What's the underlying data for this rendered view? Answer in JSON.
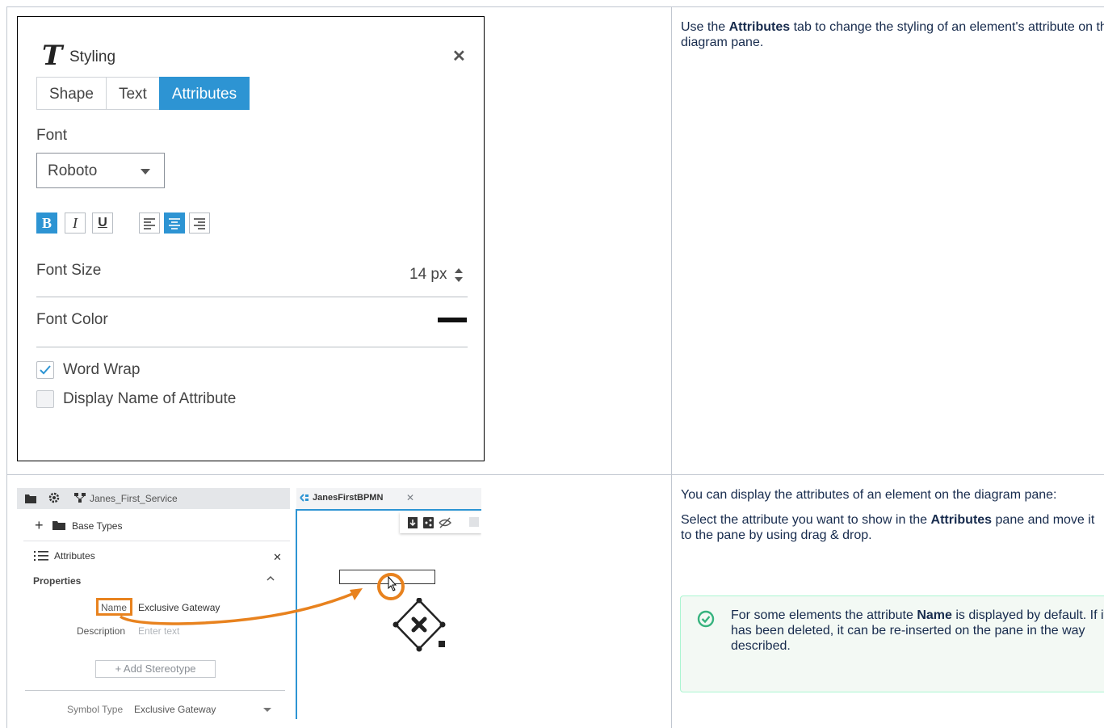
{
  "row1": {
    "description_parts": [
      "Use the ",
      "Attributes",
      " tab to change the styling of an element's attribute on the diagram pane."
    ]
  },
  "styling_panel": {
    "title": "Styling",
    "title_icon": "T",
    "close_icon": "close-icon",
    "tabs": [
      {
        "label": "Shape",
        "active": false
      },
      {
        "label": "Text",
        "active": false
      },
      {
        "label": "Attributes",
        "active": true
      }
    ],
    "font_label": "Font",
    "font_value": "Roboto",
    "format_buttons": [
      {
        "name": "bold",
        "glyph": "B",
        "active": true
      },
      {
        "name": "italic",
        "glyph": "I",
        "active": false
      },
      {
        "name": "underline",
        "glyph": "U",
        "active": false
      },
      {
        "name": "align-left",
        "glyph": "≡",
        "active": false
      },
      {
        "name": "align-center",
        "glyph": "≡",
        "active": true
      },
      {
        "name": "align-right",
        "glyph": "≡",
        "active": false
      }
    ],
    "font_size_label": "Font Size",
    "font_size_value": "14 px",
    "font_color_label": "Font Color",
    "font_color_value": "#000000",
    "word_wrap_label": "Word Wrap",
    "word_wrap_checked": true,
    "display_name_label": "Display Name of Attribute",
    "display_name_checked": false
  },
  "row2": {
    "para1": "You can display the attributes of an element on the diagram pane:",
    "para2_parts": [
      "Select the attribute you want to show in the ",
      "Attributes",
      " pane and move it to the pane by using drag & drop."
    ],
    "tip_parts": [
      "For some elements the attribute ",
      "Name",
      " is displayed by default. If it has been deleted, it can be re-inserted on the pane in the way described."
    ],
    "tip_color": "#36b37e"
  },
  "app": {
    "service_name": "Janes_First_Service",
    "diagram_tab": "JanesFirstBPMN",
    "base_types": "Base Types",
    "attributes_title": "Attributes",
    "properties_label": "Properties",
    "name_label": "Name",
    "name_value": "Exclusive Gateway",
    "description_label": "Description",
    "description_placeholder": "Enter text",
    "add_stereotype": "+ Add Stereotype",
    "symbol_type_label": "Symbol Type",
    "symbol_type_value": "Exclusive Gateway",
    "highlight_color": "#e8821e"
  }
}
